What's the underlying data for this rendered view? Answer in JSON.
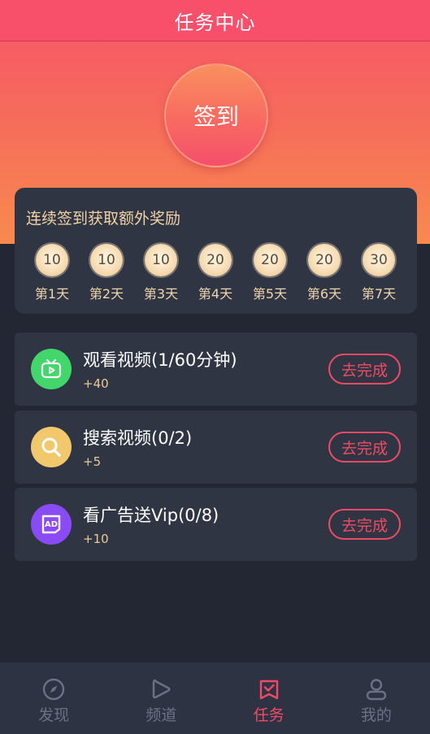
{
  "header": {
    "title": "任务中心"
  },
  "sign_in": {
    "label": "签到"
  },
  "bonus": {
    "title": "连续签到获取额外奖励",
    "days": [
      {
        "value": "10",
        "label": "第1天"
      },
      {
        "value": "10",
        "label": "第2天"
      },
      {
        "value": "10",
        "label": "第3天"
      },
      {
        "value": "20",
        "label": "第4天"
      },
      {
        "value": "20",
        "label": "第5天"
      },
      {
        "value": "20",
        "label": "第6天"
      },
      {
        "value": "30",
        "label": "第7天"
      }
    ]
  },
  "tasks": [
    {
      "name": "观看视频(1/60分钟)",
      "reward": "+40",
      "action": "去完成",
      "icon": "tv-icon",
      "color": "#43d66b"
    },
    {
      "name": "搜索视频(0/2)",
      "reward": "+5",
      "action": "去完成",
      "icon": "search-icon",
      "color": "#f1c86b"
    },
    {
      "name": "看广告送Vip(0/8)",
      "reward": "+10",
      "action": "去完成",
      "icon": "ad-icon",
      "color": "#8a4bf5"
    }
  ],
  "tabbar": {
    "items": [
      {
        "label": "发现",
        "icon": "compass-icon"
      },
      {
        "label": "频道",
        "icon": "play-icon"
      },
      {
        "label": "任务",
        "icon": "task-icon"
      },
      {
        "label": "我的",
        "icon": "user-icon"
      }
    ],
    "active_color": "#f24a66",
    "inactive_color": "#6b7283"
  }
}
